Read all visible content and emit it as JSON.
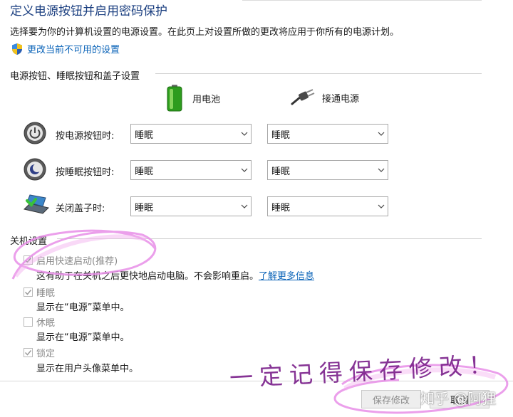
{
  "header": {
    "title": "定义电源按钮并启用密码保护",
    "description": "选择要为你的计算机设置的电源设置。在此页上对设置所做的更改将应用于你所有的电源计划。",
    "change_link": "更改当前不可用的设置"
  },
  "power_section": {
    "heading": "电源按钮、睡眠按钮和盖子设置",
    "columns": {
      "battery": "用电池",
      "plugged_in": "接通电源"
    },
    "rows": [
      {
        "label": "按电源按钮时:",
        "battery": "睡眠",
        "plugged_in": "睡眠",
        "icon": "power-button-icon"
      },
      {
        "label": "按睡眠按钮时:",
        "battery": "睡眠",
        "plugged_in": "睡眠",
        "icon": "sleep-button-icon"
      },
      {
        "label": "关闭盖子时:",
        "battery": "睡眠",
        "plugged_in": "睡眠",
        "icon": "laptop-lid-icon"
      }
    ]
  },
  "shutdown_section": {
    "heading": "关机设置",
    "options": [
      {
        "label": "启用快速启动(推荐)",
        "checked": true,
        "disabled": true
      },
      {
        "label": "睡眠",
        "checked": true,
        "disabled": true
      },
      {
        "label": "休眠",
        "checked": false,
        "disabled": true
      },
      {
        "label": "锁定",
        "checked": true,
        "disabled": true
      }
    ],
    "fast_startup_desc": "这有助于在关机之后更快地启动电脑。不会影响重启。",
    "learn_more_link": "了解更多信息",
    "sleep_desc": "显示在“电源”菜单中。",
    "hibernate_desc": "显示在“电源”菜单中。",
    "lock_desc": "显示在用户头像菜单中。"
  },
  "footer": {
    "save_label": "保存修改",
    "cancel_label": "取消"
  },
  "annotation": {
    "handwritten_note": "一定记得保存修改！",
    "watermark": "知乎 @阿狸"
  },
  "colors": {
    "title": "#1b3f80",
    "link": "#0a63b8",
    "highlight_marker": "#e88ee8"
  }
}
